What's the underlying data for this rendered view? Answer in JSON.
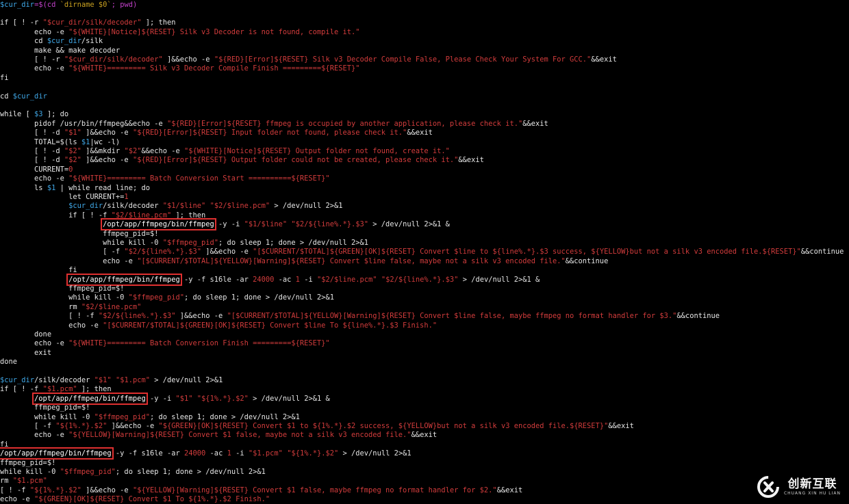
{
  "terminal": {
    "highlight_color": "#e03030",
    "lines": [
      [
        [
          "$",
          "cyan"
        ],
        [
          "cur_dir",
          "cyan"
        ],
        [
          "=$(cd ",
          "purp"
        ],
        [
          "`dirname $0`",
          "brown"
        ],
        [
          "; pwd)",
          "purp"
        ]
      ],
      [],
      [
        [
          "if [ ! -r ",
          ""
        ],
        [
          "\"$cur_dir/silk/decoder\"",
          "red"
        ],
        [
          " ]; then",
          ""
        ]
      ],
      [
        [
          "        echo -e ",
          ""
        ],
        [
          "\"${WHITE}[Notice]${RESET} Silk v3 Decoder is not found, compile it.\"",
          "red"
        ]
      ],
      [
        [
          "        cd ",
          ""
        ],
        [
          "$cur_dir",
          "cyan"
        ],
        [
          "/silk",
          ""
        ]
      ],
      [
        [
          "        make && make decoder",
          ""
        ]
      ],
      [
        [
          "        [ ! -r ",
          ""
        ],
        [
          "\"$cur_dir/silk/decoder\"",
          "red"
        ],
        [
          " ]&&echo -e ",
          ""
        ],
        [
          "\"${RED}[Error]${RESET} Silk v3 Decoder Compile False, Please Check Your System For GCC.\"",
          "red"
        ],
        [
          "&&exit",
          ""
        ]
      ],
      [
        [
          "        echo -e ",
          ""
        ],
        [
          "\"${WHITE}========= Silk v3 Decoder Compile Finish =========${RESET}\"",
          "red"
        ]
      ],
      [
        [
          "fi",
          ""
        ]
      ],
      [],
      [
        [
          "cd ",
          ""
        ],
        [
          "$cur_dir",
          "cyan"
        ]
      ],
      [],
      [
        [
          "while [ ",
          ""
        ],
        [
          "$3",
          "cyan"
        ],
        [
          " ]; do",
          ""
        ]
      ],
      [
        [
          "        pidof /usr/bin/ffmpeg&&echo -e ",
          ""
        ],
        [
          "\"${RED}[Error]${RESET} ffmpeg is occupied by another application, please check it.\"",
          "red"
        ],
        [
          "&&exit",
          ""
        ]
      ],
      [
        [
          "        [ ! -d ",
          ""
        ],
        [
          "\"$1\"",
          "red"
        ],
        [
          " ]&&echo -e ",
          ""
        ],
        [
          "\"${RED}[Error]${RESET} Input folder not found, please check it.\"",
          "red"
        ],
        [
          "&&exit",
          ""
        ]
      ],
      [
        [
          "        TOTAL=$(ls ",
          ""
        ],
        [
          "$1",
          "cyan"
        ],
        [
          "|wc -l)",
          ""
        ]
      ],
      [
        [
          "        [ ! -d ",
          ""
        ],
        [
          "\"$2\"",
          "red"
        ],
        [
          " ]&&mkdir ",
          ""
        ],
        [
          "\"$2\"",
          "red"
        ],
        [
          "&&echo -e ",
          ""
        ],
        [
          "\"${WHITE}[Notice]${RESET} Output folder not found, create it.\"",
          "red"
        ]
      ],
      [
        [
          "        [ ! -d ",
          ""
        ],
        [
          "\"$2\"",
          "red"
        ],
        [
          " ]&&echo -e ",
          ""
        ],
        [
          "\"${RED}[Error]${RESET} Output folder could not be created, please check it.\"",
          "red"
        ],
        [
          "&&exit",
          ""
        ]
      ],
      [
        [
          "        CURRENT=",
          ""
        ],
        [
          "0",
          "red"
        ]
      ],
      [
        [
          "        echo -e ",
          ""
        ],
        [
          "\"${WHITE}========= Batch Conversion Start ==========${RESET}\"",
          "red"
        ]
      ],
      [
        [
          "        ls ",
          ""
        ],
        [
          "$1",
          "cyan"
        ],
        [
          " | while read line; do",
          ""
        ]
      ],
      [
        [
          "                let CURRENT+=",
          ""
        ],
        [
          "1",
          "red"
        ]
      ],
      [
        [
          "                ",
          ""
        ],
        [
          "$cur_dir",
          "cyan"
        ],
        [
          "/silk/decoder ",
          ""
        ],
        [
          "\"$1/$line\"",
          "red"
        ],
        [
          " ",
          ""
        ],
        [
          "\"$2/$line.pcm\"",
          "red"
        ],
        [
          " > /dev/null 2>&1",
          ""
        ]
      ],
      [
        [
          "                if [ ! -f ",
          ""
        ],
        [
          "\"$2/$line.pcm\"",
          "red"
        ],
        [
          " ]; then",
          ""
        ]
      ],
      [
        [
          "                        ",
          ""
        ],
        [
          "/opt/app/ffmpeg/bin/ffmpeg",
          "hl"
        ],
        [
          " -y -i ",
          ""
        ],
        [
          "\"$1/$line\"",
          "red"
        ],
        [
          " ",
          ""
        ],
        [
          "\"$2/${line%.*}.$3\"",
          "red"
        ],
        [
          " > /dev/null 2>&1 &",
          ""
        ]
      ],
      [
        [
          "                        ffmpeg_pid=$!",
          ""
        ]
      ],
      [
        [
          "                        while kill -0 ",
          ""
        ],
        [
          "\"$ffmpeg_pid\"",
          "red"
        ],
        [
          "; do sleep 1; done > /dev/null 2>&1",
          ""
        ]
      ],
      [
        [
          "                        [ -f ",
          ""
        ],
        [
          "\"$2/${line%.*}.$3\"",
          "red"
        ],
        [
          " ]&&echo -e ",
          ""
        ],
        [
          "\"[$CURRENT/$TOTAL]${GREEN}[OK]${RESET} Convert $line to ${line%.*}.$3 success, ${YELLOW}but not a silk v3 encoded file.${RESET}\"",
          "red"
        ],
        [
          "&&continue",
          ""
        ]
      ],
      [
        [
          "                        echo -e ",
          ""
        ],
        [
          "\"[$CURRENT/$TOTAL]${YELLOW}[Warning]${RESET} Convert $line false, maybe not a silk v3 encoded file.\"",
          "red"
        ],
        [
          "&&continue",
          ""
        ]
      ],
      [
        [
          "                fi",
          ""
        ]
      ],
      [
        [
          "                ",
          ""
        ],
        [
          "/opt/app/ffmpeg/bin/ffmpeg",
          "hl"
        ],
        [
          " -y -f s16le -ar ",
          ""
        ],
        [
          "24000",
          "red"
        ],
        [
          " -ac ",
          ""
        ],
        [
          "1",
          "red"
        ],
        [
          " -i ",
          ""
        ],
        [
          "\"$2/$line.pcm\"",
          "red"
        ],
        [
          " ",
          ""
        ],
        [
          "\"$2/${line%.*}.$3\"",
          "red"
        ],
        [
          " > /dev/null 2>&1 &",
          ""
        ]
      ],
      [
        [
          "                ffmpeg_pid=$!",
          ""
        ]
      ],
      [
        [
          "                while kill -0 ",
          ""
        ],
        [
          "\"$ffmpeg_pid\"",
          "red"
        ],
        [
          "; do sleep 1; done > /dev/null 2>&1",
          ""
        ]
      ],
      [
        [
          "                rm ",
          ""
        ],
        [
          "\"$2/$line.pcm\"",
          "red"
        ]
      ],
      [
        [
          "                [ ! -f ",
          ""
        ],
        [
          "\"$2/${line%.*}.$3\"",
          "red"
        ],
        [
          " ]&&echo -e ",
          ""
        ],
        [
          "\"[$CURRENT/$TOTAL]${YELLOW}[Warning]${RESET} Convert $line false, maybe ffmpeg no format handler for $3.\"",
          "red"
        ],
        [
          "&&continue",
          ""
        ]
      ],
      [
        [
          "                echo -e ",
          ""
        ],
        [
          "\"[$CURRENT/$TOTAL]${GREEN}[OK]${RESET} Convert $line To ${line%.*}.$3 Finish.\"",
          "red"
        ]
      ],
      [
        [
          "        done",
          ""
        ]
      ],
      [
        [
          "        echo -e ",
          ""
        ],
        [
          "\"${WHITE}========= Batch Conversion Finish =========${RESET}\"",
          "red"
        ]
      ],
      [
        [
          "        exit",
          ""
        ]
      ],
      [
        [
          "done",
          ""
        ]
      ],
      [],
      [
        [
          "$cur_dir",
          "cyan"
        ],
        [
          "/silk/decoder ",
          ""
        ],
        [
          "\"$1\"",
          "red"
        ],
        [
          " ",
          ""
        ],
        [
          "\"$1.pcm\"",
          "red"
        ],
        [
          " > /dev/null 2>&1",
          ""
        ]
      ],
      [
        [
          "if [ ! -f ",
          ""
        ],
        [
          "\"$1.pcm\"",
          "red"
        ],
        [
          " ]; then",
          ""
        ]
      ],
      [
        [
          "        ",
          ""
        ],
        [
          "/opt/app/ffmpeg/bin/ffmpeg",
          "hl"
        ],
        [
          " -y -i ",
          ""
        ],
        [
          "\"$1\"",
          "red"
        ],
        [
          " ",
          ""
        ],
        [
          "\"${1%.*}.$2\"",
          "red"
        ],
        [
          " > /dev/null 2>&1 &",
          ""
        ]
      ],
      [
        [
          "        ffmpeg_pid=$!",
          ""
        ]
      ],
      [
        [
          "        while kill -0 ",
          ""
        ],
        [
          "\"$ffmpeg_pid\"",
          "red"
        ],
        [
          "; do sleep 1; done > /dev/null 2>&1",
          ""
        ]
      ],
      [
        [
          "        [ -f ",
          ""
        ],
        [
          "\"${1%.*}.$2\"",
          "red"
        ],
        [
          " ]&&echo -e ",
          ""
        ],
        [
          "\"${GREEN}[OK]${RESET} Convert $1 to ${1%.*}.$2 success, ${YELLOW}but not a silk v3 encoded file.${RESET}\"",
          "red"
        ],
        [
          "&&exit",
          ""
        ]
      ],
      [
        [
          "        echo -e ",
          ""
        ],
        [
          "\"${YELLOW}[Warning]${RESET} Convert $1 false, maybe not a silk v3 encoded file.\"",
          "red"
        ],
        [
          "&&exit",
          ""
        ]
      ],
      [
        [
          "fi",
          ""
        ]
      ],
      [
        [
          "/opt/app/ffmpeg/bin/ffmpeg",
          "hl"
        ],
        [
          " -y -f s16le -ar ",
          ""
        ],
        [
          "24000",
          "red"
        ],
        [
          " -ac ",
          ""
        ],
        [
          "1",
          "red"
        ],
        [
          " -i ",
          ""
        ],
        [
          "\"$1.pcm\"",
          "red"
        ],
        [
          " ",
          ""
        ],
        [
          "\"${1%.*}.$2\"",
          "red"
        ],
        [
          " > /dev/null 2>&1",
          ""
        ]
      ],
      [
        [
          "ffmpeg_pid=$!",
          ""
        ]
      ],
      [
        [
          "while kill -0 ",
          ""
        ],
        [
          "\"$ffmpeg_pid\"",
          "red"
        ],
        [
          "; do sleep 1; done > /dev/null 2>&1",
          ""
        ]
      ],
      [
        [
          "rm ",
          ""
        ],
        [
          "\"$1.pcm\"",
          "red"
        ]
      ],
      [
        [
          "[ ! -f ",
          ""
        ],
        [
          "\"${1%.*}.$2\"",
          "red"
        ],
        [
          " ]&&echo -e ",
          ""
        ],
        [
          "\"${YELLOW}[Warning]${RESET} Convert $1 false, maybe ffmpeg no format handler for $2.\"",
          "red"
        ],
        [
          "&&exit",
          ""
        ]
      ],
      [
        [
          "echo -e ",
          ""
        ],
        [
          "\"${GREEN}[OK]${RESET} Convert $1 To ${1%.*}.$2 Finish.\"",
          "red"
        ]
      ]
    ]
  },
  "watermark": {
    "brand_cn": "创新互联",
    "brand_en": "CHUANG XIN HU LIAN"
  }
}
